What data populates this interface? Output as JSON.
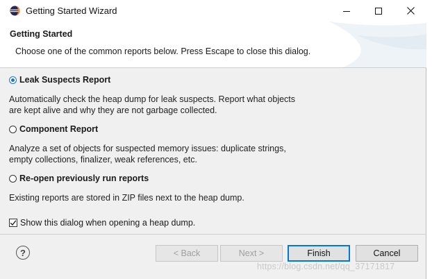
{
  "window": {
    "title": "Getting Started Wizard"
  },
  "header": {
    "title": "Getting Started",
    "message": "Choose one of the common reports below. Press Escape to close this dialog."
  },
  "options": [
    {
      "label": "Leak Suspects Report",
      "description": "Automatically check the heap dump for leak suspects. Report what objects",
      "description2": "are kept alive and why they are not garbage collected.",
      "selected": true
    },
    {
      "label": "Component Report",
      "description": "Analyze a set of objects for suspected memory issues: duplicate strings,",
      "description2": "empty collections, finalizer, weak references, etc.",
      "selected": false
    },
    {
      "label": "Re-open previously run reports",
      "description": "Existing reports are stored in ZIP files next to the heap dump.",
      "selected": false
    }
  ],
  "checkbox": {
    "label": "Show this dialog when opening a heap dump.",
    "checked": true
  },
  "buttons": {
    "back": "< Back",
    "next": "Next >",
    "finish": "Finish",
    "cancel": "Cancel"
  },
  "watermark": "https://blog.csdn.net/qq_37171817",
  "colors": {
    "accent": "#1f74c8",
    "dialog_bg": "#f0f0f0",
    "default_button_border": "#0078d7"
  }
}
